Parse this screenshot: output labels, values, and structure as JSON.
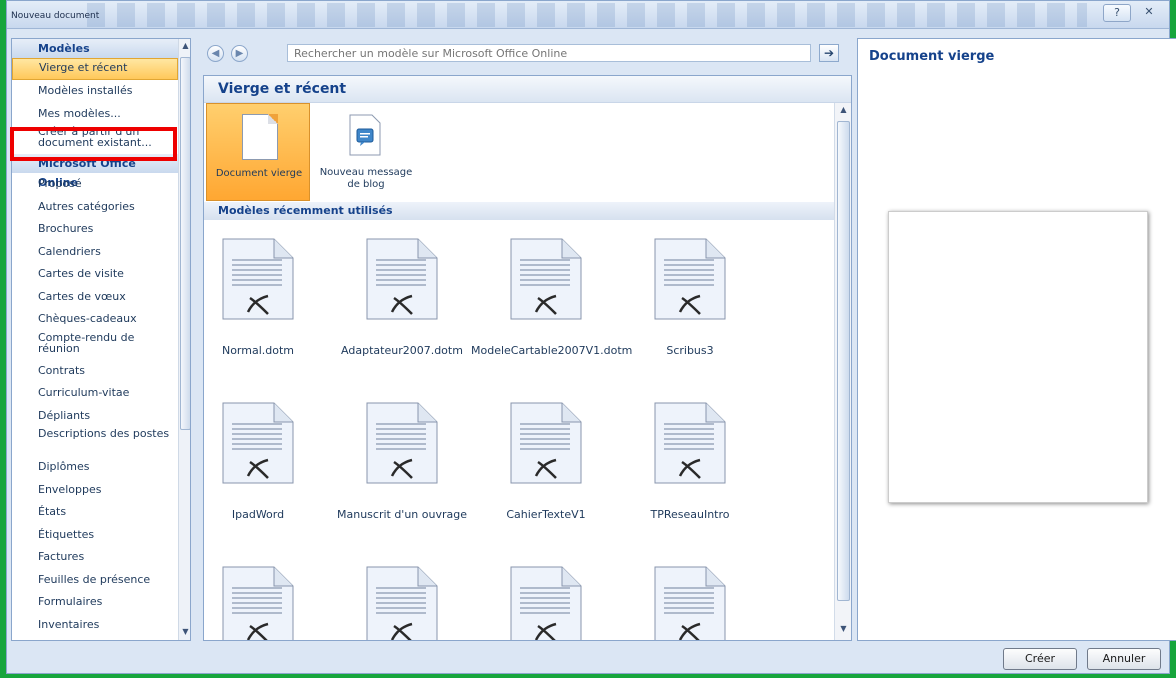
{
  "window": {
    "title": "Nouveau document",
    "help": "?",
    "close": "✕"
  },
  "sidebar": {
    "items": [
      {
        "label": "Modèles",
        "type": "header"
      },
      {
        "label": "Vierge et récent",
        "type": "item",
        "selected": true
      },
      {
        "label": "Modèles installés",
        "type": "item"
      },
      {
        "label": "Mes modèles...",
        "type": "item"
      },
      {
        "label": "Créer à partir d'un document existant...",
        "type": "item",
        "two_line": true
      },
      {
        "label": "Microsoft Office Online",
        "type": "header"
      },
      {
        "label": "Proposé",
        "type": "item"
      },
      {
        "label": "Autres catégories",
        "type": "item"
      },
      {
        "label": "Brochures",
        "type": "item"
      },
      {
        "label": "Calendriers",
        "type": "item"
      },
      {
        "label": "Cartes de visite",
        "type": "item"
      },
      {
        "label": "Cartes de vœux",
        "type": "item"
      },
      {
        "label": "Chèques-cadeaux",
        "type": "item"
      },
      {
        "label": "Compte-rendu de réunion",
        "type": "item",
        "two_line": true
      },
      {
        "label": "Contrats",
        "type": "item"
      },
      {
        "label": "Curriculum-vitae",
        "type": "item"
      },
      {
        "label": "Dépliants",
        "type": "item"
      },
      {
        "label": "Descriptions des postes",
        "type": "item",
        "two_line": true
      },
      {
        "label": "Diplômes",
        "type": "item"
      },
      {
        "label": "Enveloppes",
        "type": "item"
      },
      {
        "label": "États",
        "type": "item"
      },
      {
        "label": "Étiquettes",
        "type": "item"
      },
      {
        "label": "Factures",
        "type": "item"
      },
      {
        "label": "Feuilles de présence",
        "type": "item"
      },
      {
        "label": "Formulaires",
        "type": "item"
      },
      {
        "label": "Inventaires",
        "type": "item"
      }
    ]
  },
  "search": {
    "placeholder": "Rechercher un modèle sur Microsoft Office Online",
    "back_icon": "arrow-left-icon",
    "forward_icon": "arrow-right-icon",
    "go_icon": "arrow-right-icon"
  },
  "main": {
    "title": "Vierge et récent",
    "top_tiles": [
      {
        "label": "Document vierge",
        "selected": true
      },
      {
        "label": "Nouveau message de blog",
        "selected": false
      }
    ],
    "section_title": "Modèles récemment utilisés",
    "recent": [
      "Normal.dotm",
      "Adaptateur2007.dotm",
      "ModeleCartable2007V1.dotm",
      "Scribus3",
      "IpadWord",
      "Manuscrit d'un ouvrage",
      "CahierTexteV1",
      "TPReseauIntro",
      "",
      "",
      "",
      ""
    ]
  },
  "preview": {
    "title": "Document vierge"
  },
  "buttons": {
    "create": "Créer",
    "cancel": "Annuler"
  },
  "colors": {
    "selection": "#ffc85a",
    "accent": "#15428b",
    "highlight": "#e00000"
  }
}
